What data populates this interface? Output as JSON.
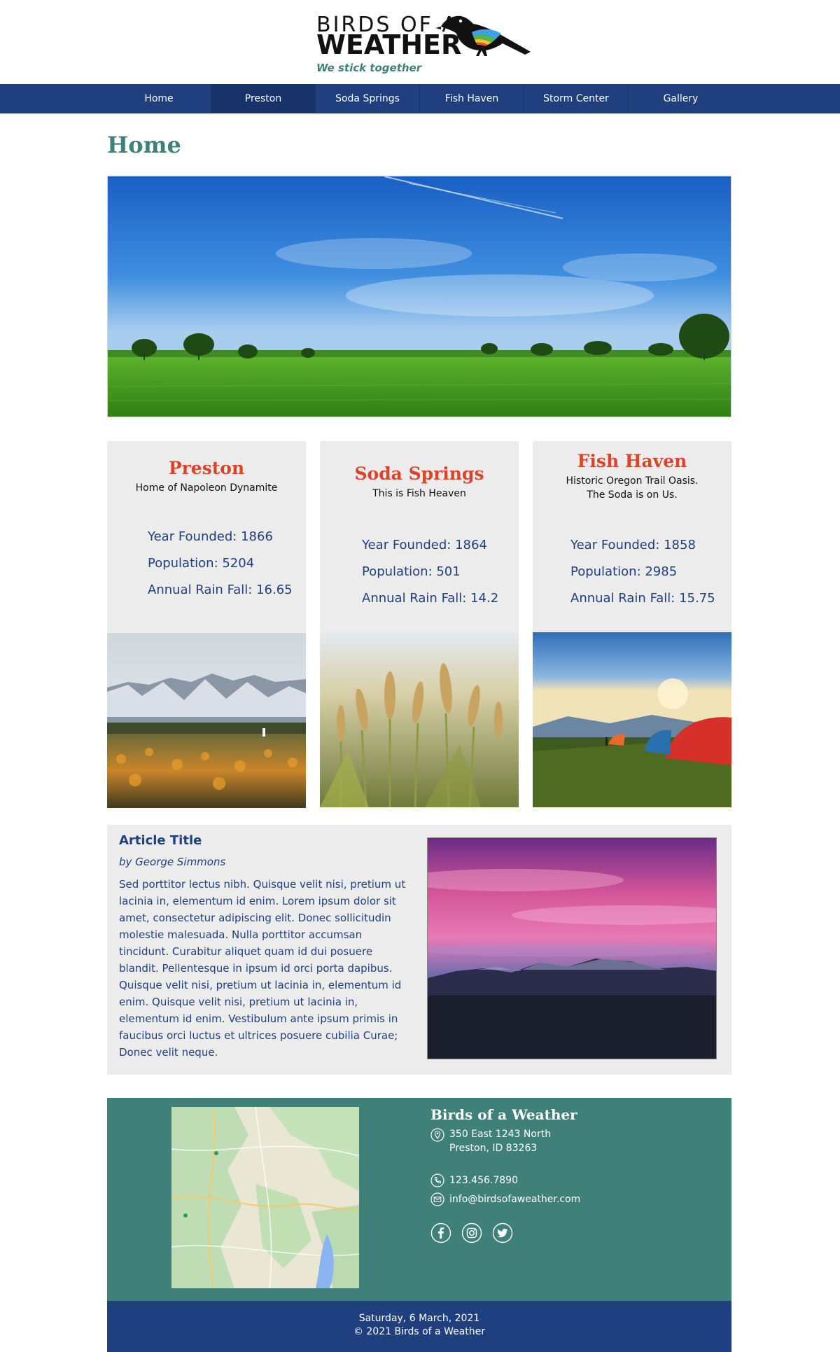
{
  "header": {
    "logo_line1": "BIRDS OF A",
    "logo_line2": "WEATHER",
    "tagline": "We stick together"
  },
  "nav": {
    "items": [
      {
        "label": "Home",
        "active": false
      },
      {
        "label": "Preston",
        "active": true
      },
      {
        "label": "Soda Springs",
        "active": false
      },
      {
        "label": "Fish Haven",
        "active": false
      },
      {
        "label": "Storm Center",
        "active": false
      },
      {
        "label": "Gallery",
        "active": false
      }
    ]
  },
  "page": {
    "title": "Home"
  },
  "towns": [
    {
      "name": "Preston",
      "motto": "Home of Napoleon Dynamite",
      "year_founded": "Year Founded: 1866",
      "population": "Population: 5204",
      "rainfall": "Annual Rain Fall: 16.65"
    },
    {
      "name": "Soda Springs",
      "motto": "This is Fish Heaven",
      "year_founded": "Year Founded: 1864",
      "population": "Population: 501",
      "rainfall": "Annual Rain Fall: 14.2"
    },
    {
      "name": "Fish Haven",
      "motto_line1": "Historic Oregon Trail Oasis.",
      "motto_line2": "The Soda is on Us.",
      "year_founded": "Year Founded: 1858",
      "population": "Population: 2985",
      "rainfall": "Annual Rain Fall: 15.75"
    }
  ],
  "article": {
    "title": "Article Title",
    "author": "by George Simmons",
    "body": "Sed porttitor lectus nibh. Quisque velit nisi, pretium ut lacinia in, elementum id enim. Lorem ipsum dolor sit amet, consectetur adipiscing elit. Donec sollicitudin molestie malesuada. Nulla porttitor accumsan tincidunt. Curabitur aliquet quam id dui posuere blandit. Pellentesque in ipsum id orci porta dapibus. Quisque velit nisi, pretium ut lacinia in, elementum id enim. Quisque velit nisi, pretium ut lacinia in, elementum id enim. Vestibulum ante ipsum primis in faucibus orci luctus et ultrices posuere cubilia Curae; Donec velit neque."
  },
  "contact": {
    "name": "Birds of a Weather",
    "address_line1": "350 East 1243 North",
    "address_line2": "Preston, ID 83263",
    "phone": "123.456.7890",
    "email": "info@birdsofaweather.com",
    "social": [
      "facebook-icon",
      "instagram-icon",
      "twitter-icon"
    ]
  },
  "footer": {
    "date": "Saturday, 6 March, 2021",
    "copyright": "© 2021 Birds of a Weather"
  },
  "colors": {
    "navy": "#1f3f7e",
    "teal": "#3f8078",
    "accent_red": "#d8452a",
    "card_bg": "#ececec"
  }
}
